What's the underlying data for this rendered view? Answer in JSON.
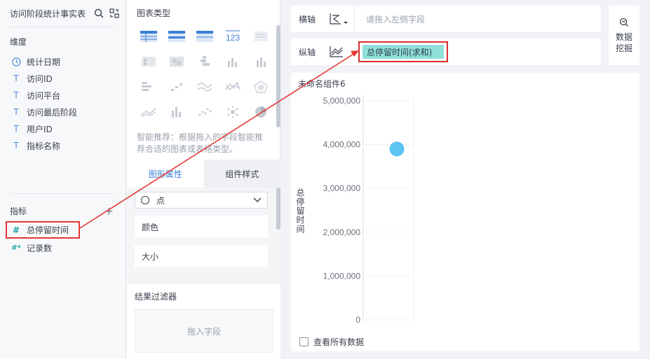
{
  "left": {
    "title": "访问阶段统计事实表",
    "dimensions_title": "维度",
    "dimensions": [
      {
        "icon": "clock-icon",
        "label": "统计日期"
      },
      {
        "icon": "text-type-icon",
        "label": "访问ID"
      },
      {
        "icon": "text-type-icon",
        "label": "访问平台"
      },
      {
        "icon": "text-type-icon",
        "label": "访问最后阶段"
      },
      {
        "icon": "text-type-icon",
        "label": "用户ID"
      },
      {
        "icon": "text-type-icon",
        "label": "指标名称"
      }
    ],
    "metrics_title": "指标",
    "metrics": [
      {
        "icon": "hash-icon",
        "label": "总停留时间"
      },
      {
        "icon": "hash-star-icon",
        "label": "记录数"
      }
    ],
    "glyphs": {
      "text_type": "T",
      "hash": "#",
      "hash_star": "#*",
      "add": "+"
    }
  },
  "middle": {
    "chart_types_title": "图表类型",
    "recommend_text": "智能推荐：根据拖入的字段智能推荐合适的图表或表格类型。",
    "number_card_label": "123",
    "tabs": [
      {
        "label": "图形属性",
        "active": true
      },
      {
        "label": "组件样式",
        "active": false
      }
    ],
    "shape_select": "点",
    "props": {
      "color": "颜色",
      "size": "大小"
    },
    "filter_title": "结果过滤器",
    "filter_placeholder": "拖入字段"
  },
  "right": {
    "x_axis_label": "横轴",
    "x_axis_placeholder": "请拖入左侧字段",
    "y_axis_label": "纵轴",
    "y_axis_field": "总停留时间(求和)",
    "mining_label_1": "数据",
    "mining_label_2": "挖掘",
    "chart_title": "未命名组件6",
    "y_axis_title": "总停留时间",
    "show_all_label": "查看所有数据"
  },
  "colors": {
    "accent": "#3b7fd6",
    "highlight_red": "#e53935",
    "pill_bg": "#8fe0d8",
    "point": "#5bc4f0"
  },
  "chart_data": {
    "type": "scatter",
    "y_ticks": [
      "5,000,000",
      "4,000,000",
      "3,000,000",
      "2,000,000",
      "1,000,000",
      "0"
    ],
    "ylim": [
      0,
      5000000
    ],
    "ylabel": "总停留时间",
    "points": [
      {
        "y": 3900000
      }
    ]
  }
}
